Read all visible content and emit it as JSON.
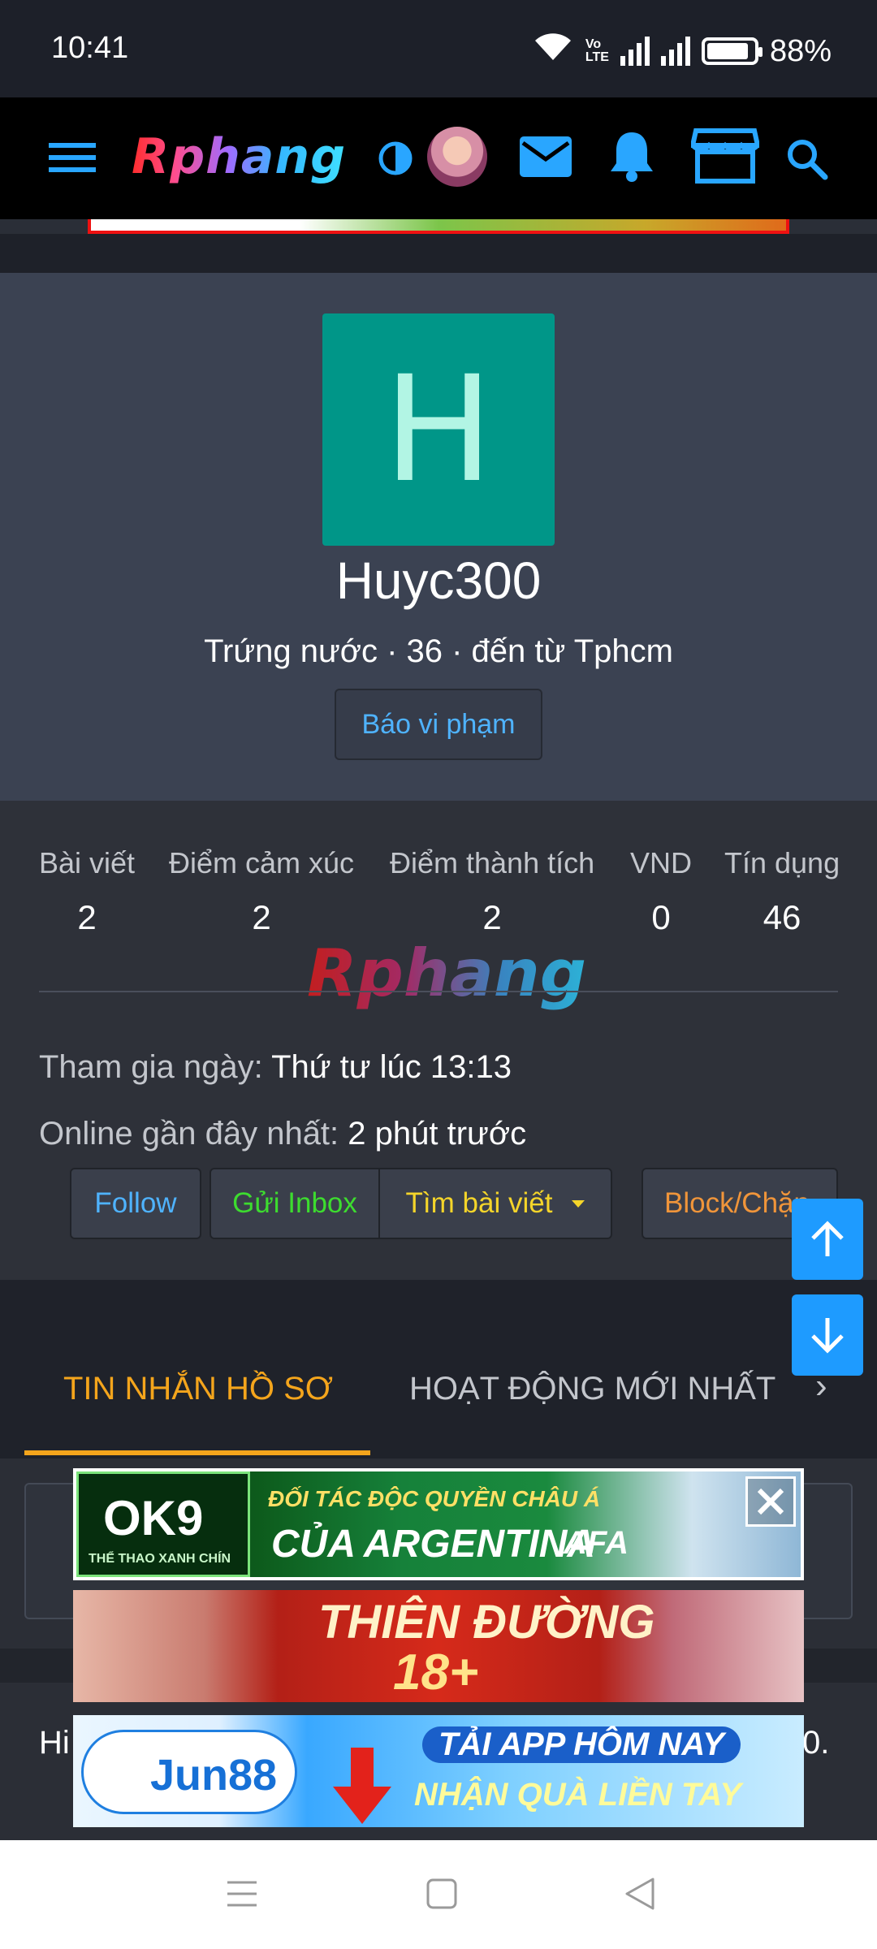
{
  "status_bar": {
    "time": "10:41",
    "volte_top": "Vo",
    "volte_bottom": "LTE",
    "battery": "88%"
  },
  "header": {
    "logo": "Rphang"
  },
  "profile": {
    "avatar_letter": "H",
    "username": "Huyc300",
    "subline": "Trứng nước · 36 · đến từ Tphcm",
    "report_label": "Báo vi phạm"
  },
  "stats": [
    {
      "label": "Bài viết",
      "value": "2"
    },
    {
      "label": "Điểm cảm xúc",
      "value": "2"
    },
    {
      "label": "Điểm thành tích",
      "value": "2"
    },
    {
      "label": "VND",
      "value": "0"
    },
    {
      "label": "Tín dụng",
      "value": "46"
    }
  ],
  "watermark": "Rphang",
  "joined": {
    "label": "Tham gia ngày:",
    "value": "Thứ tư lúc 13:13"
  },
  "last_seen": {
    "label": "Online gần đây nhất:",
    "value": "2 phút trước"
  },
  "actions": {
    "follow": "Follow",
    "inbox": "Gửi Inbox",
    "find_posts": "Tìm bài viết",
    "block": "Block/Chặn"
  },
  "tabs": {
    "profile_messages": "TIN NHẮN HỒ SƠ",
    "latest_activity": "HOẠT ĐỘNG MỚI NHẤT",
    "more": "›"
  },
  "content": {
    "hi_text": "Hi",
    "hi_end": "0."
  },
  "ads": [
    {
      "brand": "OK9",
      "brand_sub": "THỂ THAO XANH CHÍN",
      "line1": "ĐỐI TÁC ĐỘC QUYỀN CHÂU Á",
      "line2": "CỦA ARGENTINA",
      "badge": "AFA"
    },
    {
      "line1": "THIÊN ĐƯỜNG",
      "line2": "18+"
    },
    {
      "brand": "Jun88",
      "line1": "TẢI APP HÔM NAY",
      "line2": "NHẬN QUÀ LIỀN TAY"
    }
  ],
  "colors": {
    "accent_blue": "#1e9bff",
    "tab_active": "#f4a51c",
    "follow": "#4fb3ff",
    "inbox": "#3ddc2f",
    "find": "#f5d52a",
    "block": "#f0953a",
    "avatar_bg": "#009688"
  }
}
